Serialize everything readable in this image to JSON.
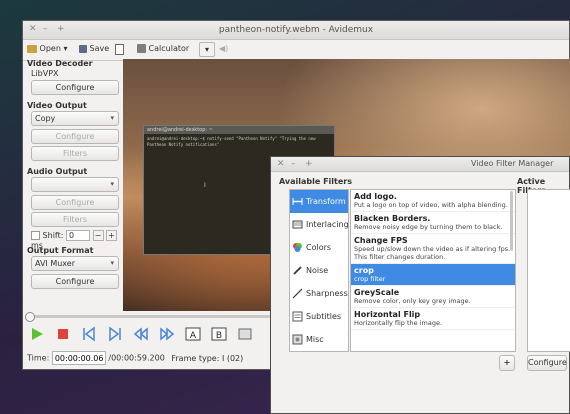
{
  "main_window": {
    "title": "pantheon-notify.webm - Avidemux",
    "toolbar": {
      "open": "Open",
      "save": "Save",
      "calculator": "Calculator"
    },
    "sidebar": {
      "video_decoder": {
        "heading": "Video Decoder",
        "codec": "LibVPX",
        "configure": "Configure"
      },
      "video_output": {
        "heading": "Video Output",
        "value": "Copy",
        "configure": "Configure",
        "filters": "Filters"
      },
      "audio_output": {
        "heading": "Audio Output",
        "value": "",
        "configure": "Configure",
        "filters": "Filters",
        "shift_label": "Shift:",
        "shift_value": "0",
        "shift_unit": "ms"
      },
      "output_format": {
        "heading": "Output Format",
        "value": "AVI Muxer",
        "configure": "Configure"
      }
    },
    "terminal": {
      "title": "andrei@andrei-desktop: ~",
      "line1": "andrei@andrei-desktop:~$ notify-send \"Pantheon Notify\" \"Trying the new Pantheon Notify notifications\"",
      "line2": "",
      "cursor": "I"
    },
    "status": {
      "time_label": "Time:",
      "time_value": "00:00:00.067",
      "duration": "/00:00:59.200",
      "frame_type": "Frame type: I (02)"
    }
  },
  "filter_manager": {
    "title": "Video Filter Manager",
    "available_label": "Available Filters",
    "active_label": "Active Filters",
    "categories": [
      "Transform",
      "Interlacing",
      "Colors",
      "Noise",
      "Sharpness",
      "Subtitles",
      "Misc"
    ],
    "filters": [
      {
        "name": "Add logo.",
        "desc": "Put a logo on top of video, with alpha blending."
      },
      {
        "name": "Blacken Borders.",
        "desc": "Remove noisy edge by turning them to black."
      },
      {
        "name": "Change FPS",
        "desc": "Speed up/slow down the video as if altering fps. This filter changes duration."
      },
      {
        "name": "crop",
        "desc": "crop filter"
      },
      {
        "name": "GreyScale",
        "desc": "Remove color, only key grey image."
      },
      {
        "name": "Horizontal Flip",
        "desc": "Horizontally flip the image."
      }
    ],
    "add_button": "+",
    "configure": "Configure"
  },
  "colors": {
    "selection": "#3f8ae2",
    "play_green": "#5bc236",
    "stop_red": "#e0433a",
    "nav_blue": "#4a86d8"
  }
}
